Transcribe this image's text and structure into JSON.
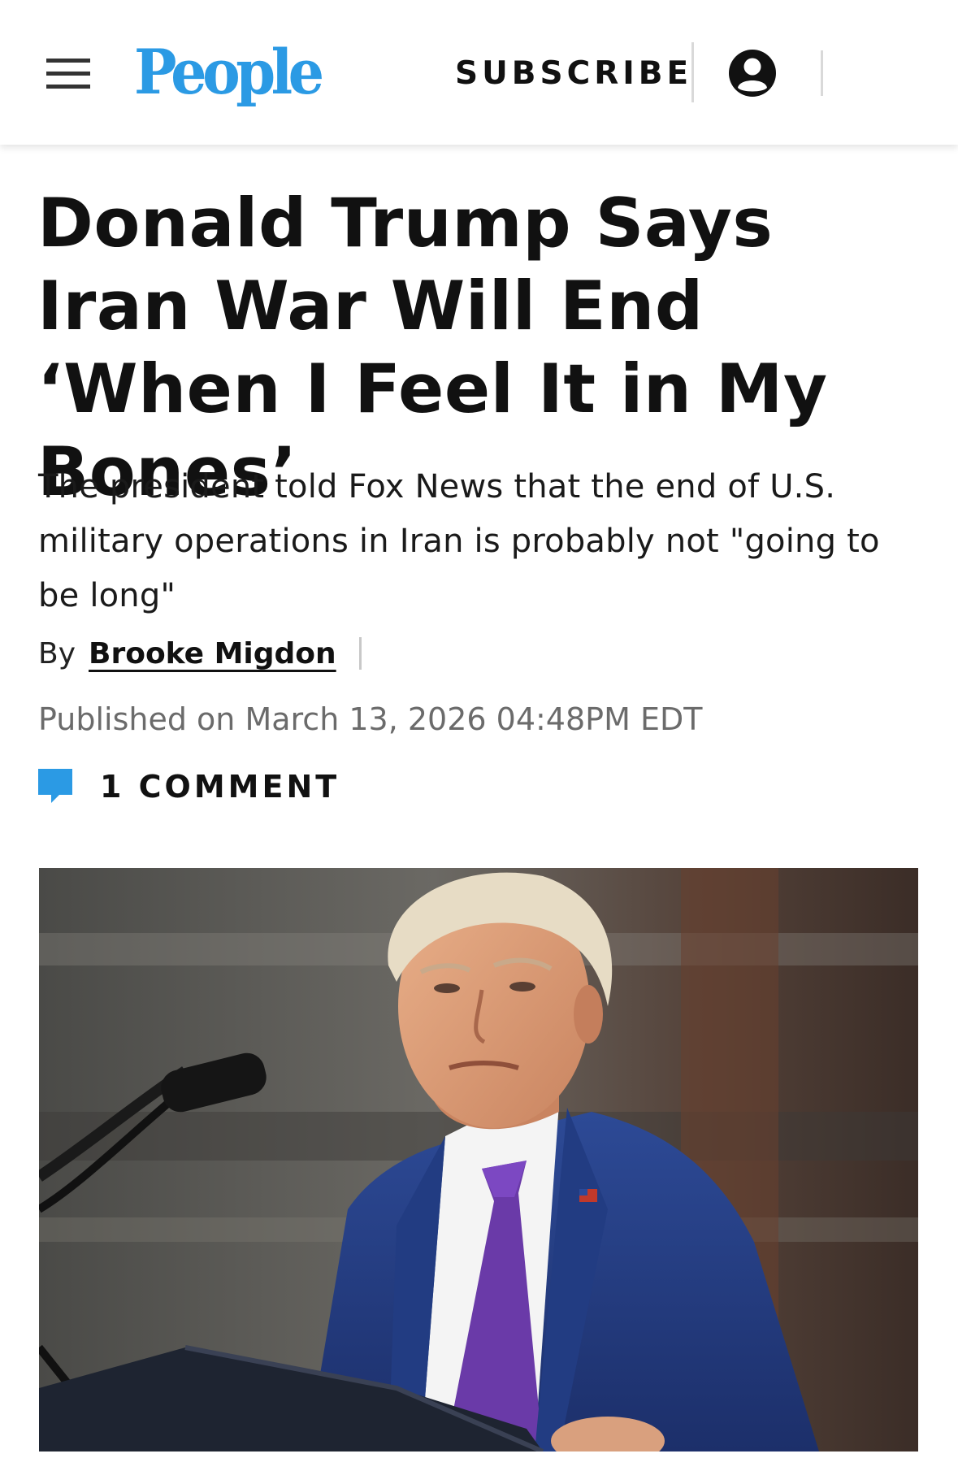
{
  "header": {
    "logo_text": "People",
    "subscribe_label": "SUBSCRIBE",
    "brand_color": "#2b9ae4",
    "menu_icon": "hamburger-menu-icon",
    "account_icon": "user-account-icon"
  },
  "article": {
    "headline": "Donald Trump Says Iran War Will End ‘When I Feel It in My Bones’",
    "dek": "The president told Fox News that the end of U.S. military operations in Iran is probably not \"going to be long\"",
    "byline": {
      "by_label": "By",
      "author": "Brooke Migdon"
    },
    "published": "Published on March 13, 2026 04:48PM EDT",
    "comments": {
      "label": "1 COMMENT",
      "icon": "comment-bubble-icon",
      "icon_color": "#2b9ae4"
    },
    "hero_image": {
      "description_icon": "photo"
    }
  }
}
